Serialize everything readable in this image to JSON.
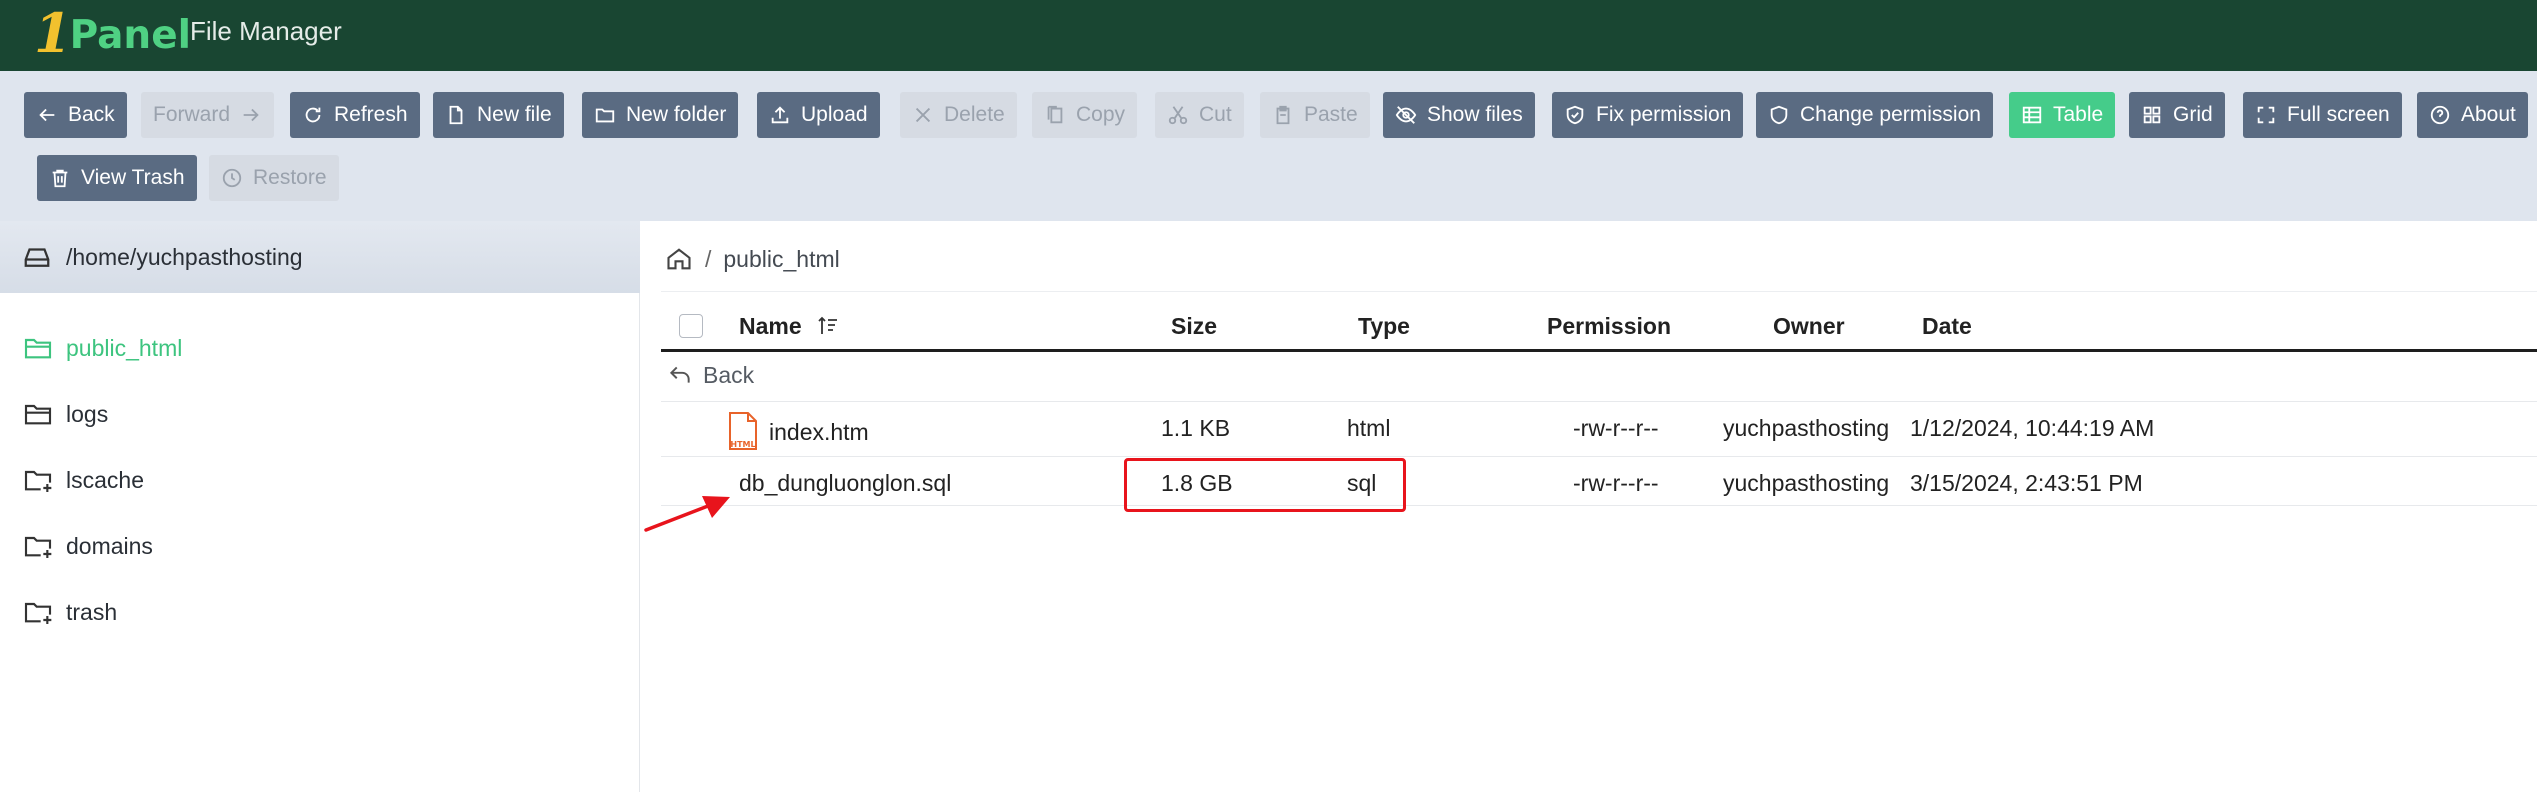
{
  "header": {
    "logo_one": "1",
    "logo_panel": "Panel",
    "app_title": "File Manager"
  },
  "toolbar": {
    "back": "Back",
    "forward": "Forward",
    "refresh": "Refresh",
    "new_file": "New file",
    "new_folder": "New folder",
    "upload": "Upload",
    "delete": "Delete",
    "copy": "Copy",
    "cut": "Cut",
    "paste": "Paste",
    "show_files": "Show files",
    "fix_permission": "Fix permission",
    "change_permission": "Change permission",
    "table": "Table",
    "grid": "Grid",
    "full_screen": "Full screen",
    "about": "About",
    "view_trash": "View Trash",
    "restore": "Restore"
  },
  "sidebar": {
    "root": "/home/yuchpasthosting",
    "items": [
      {
        "label": "public_html",
        "icon": "folder-open-icon",
        "active": true
      },
      {
        "label": "logs",
        "icon": "folder-icon",
        "active": false
      },
      {
        "label": "lscache",
        "icon": "folder-plus-icon",
        "active": false
      },
      {
        "label": "domains",
        "icon": "folder-plus-icon",
        "active": false
      },
      {
        "label": "trash",
        "icon": "folder-plus-icon",
        "active": false
      }
    ]
  },
  "breadcrumb": {
    "separator": "/",
    "current": "public_html"
  },
  "table": {
    "columns": {
      "name": "Name",
      "size": "Size",
      "type": "Type",
      "permission": "Permission",
      "owner": "Owner",
      "date": "Date"
    },
    "back_label": "Back",
    "rows": [
      {
        "name": "index.htm",
        "size": "1.1 KB",
        "type": "html",
        "permission": "-rw-r--r--",
        "owner": "yuchpasthosting",
        "date": "1/12/2024, 10:44:19 AM",
        "icon_label": "HTML"
      },
      {
        "name": "db_dungluonglon.sql",
        "size": "1.8 GB",
        "type": "sql",
        "permission": "-rw-r--r--",
        "owner": "yuchpasthosting",
        "date": "3/15/2024, 2:43:51 PM"
      }
    ]
  },
  "colors": {
    "header_bg": "#194632",
    "toolbar_btn": "#5a6b82",
    "active_green": "#45cc8a",
    "highlight_red": "#e8141c"
  }
}
